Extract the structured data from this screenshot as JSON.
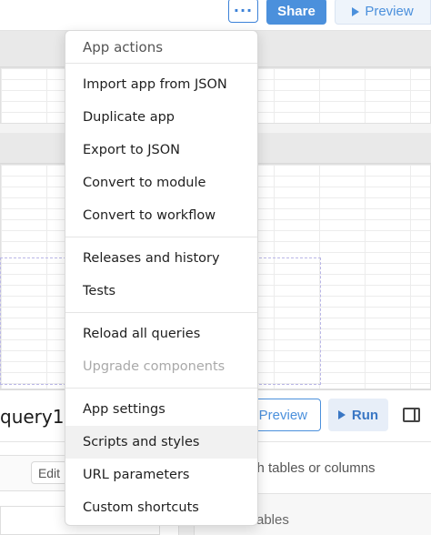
{
  "toolbar": {
    "more_label": "···",
    "share_label": "Share",
    "preview_label": "Preview"
  },
  "menu": {
    "header": "App actions",
    "groups": [
      {
        "items": [
          {
            "label": "Import app from JSON",
            "disabled": false
          },
          {
            "label": "Duplicate app",
            "disabled": false
          },
          {
            "label": "Export to JSON",
            "disabled": false
          },
          {
            "label": "Convert to module",
            "disabled": false
          },
          {
            "label": "Convert to workflow",
            "disabled": false
          }
        ]
      },
      {
        "items": [
          {
            "label": "Releases and history",
            "disabled": false
          },
          {
            "label": "Tests",
            "disabled": false
          }
        ]
      },
      {
        "items": [
          {
            "label": "Reload all queries",
            "disabled": false
          },
          {
            "label": "Upgrade components",
            "disabled": true
          }
        ]
      },
      {
        "items": [
          {
            "label": "App settings",
            "disabled": false
          },
          {
            "label": "Scripts and styles",
            "disabled": false,
            "highlighted": true
          },
          {
            "label": "URL parameters",
            "disabled": false
          },
          {
            "label": "Custom shortcuts",
            "disabled": false
          }
        ]
      }
    ]
  },
  "query_editor": {
    "title": "query1",
    "preview_label": "Preview",
    "run_label": "Run",
    "edit_label": "Edit",
    "search_placeholder": "rch tables or columns",
    "tables_label": "ables"
  },
  "icons": {
    "play": "play-icon",
    "panel_toggle": "panel-toggle-icon"
  },
  "colors": {
    "accent": "#4b90dc",
    "disabled_text": "#a9a9a9"
  }
}
